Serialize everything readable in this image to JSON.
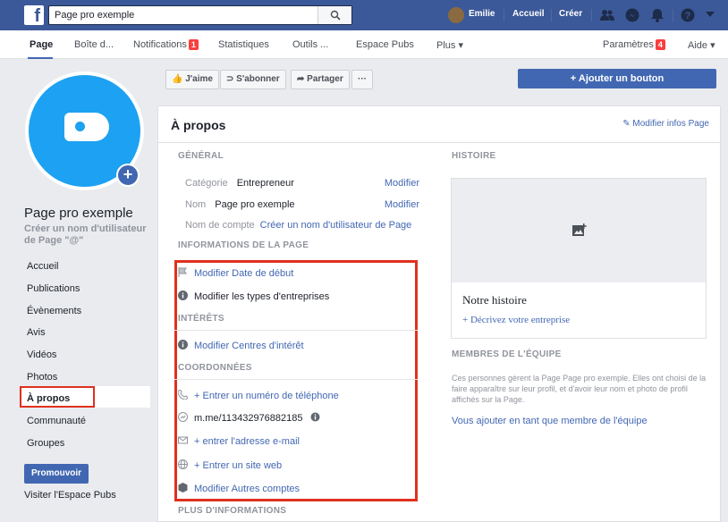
{
  "topbar": {
    "logo": "f",
    "search_value": "Page pro exemple",
    "user_name": "Emilie",
    "home_label": "Accueil",
    "create_label": "Créer"
  },
  "page_tabs": [
    {
      "label": "Page"
    },
    {
      "label": "Boîte d..."
    },
    {
      "label": "Notifications",
      "badge": "1"
    },
    {
      "label": "Statistiques"
    },
    {
      "label": "Outils ..."
    },
    {
      "label": "Espace Pubs"
    },
    {
      "label": "Plus ▾"
    },
    {
      "label": "Paramètres",
      "badge": "4"
    },
    {
      "label": "Aide ▾"
    }
  ],
  "sidebar": {
    "page_name": "Page pro exemple",
    "username_prompt": "Créer un nom d'utilisateur de Page \"@\"",
    "items": [
      "Accueil",
      "Publications",
      "Évènements",
      "Avis",
      "Vidéos",
      "Photos",
      "À propos",
      "Communauté",
      "Groupes"
    ],
    "promote_label": "Promouvoir",
    "visit_label": "Visiter l'Espace Pubs"
  },
  "action_bar": {
    "like": "J'aime",
    "subscribe": "S'abonner",
    "share": "Partager",
    "more": "···",
    "add_button": "+ Ajouter un bouton"
  },
  "about": {
    "title": "À propos",
    "edit_info": "Modifier infos Page",
    "general_heading": "GÉNÉRAL",
    "category_key": "Catégorie",
    "category_value": "Entrepreneur",
    "name_key": "Nom",
    "name_value": "Page pro exemple",
    "account_key": "Nom de compte",
    "account_value": "Créer un nom d'utilisateur de Page",
    "edit_label": "Modifier",
    "page_info_heading": "INFORMATIONS DE LA PAGE",
    "start_date": "Modifier Date de début",
    "business_types": "Modifier les types d'entreprises",
    "interests_heading": "INTÉRÊTS",
    "interests": "Modifier Centres d'intérêt",
    "contact_heading": "COORDONNÉES",
    "phone": "+ Entrer un numéro de téléphone",
    "messenger": "m.me/113432976882185",
    "email": "+ entrer l'adresse e-mail",
    "website": "+ Entrer un site web",
    "other_accounts": "Modifier Autres comptes",
    "more_info_heading": "PLUS D'INFORMATIONS"
  },
  "story": {
    "heading": "HISTOIRE",
    "title": "Notre histoire",
    "describe": "+ Décrivez votre entreprise"
  },
  "team": {
    "heading": "MEMBRES DE L'ÉQUIPE",
    "description": "Ces personnes gèrent la Page Page pro exemple. Elles ont choisi de la faire apparaître sur leur profil, et d'avoir leur nom et photo de profil affichés sur la Page.",
    "add_self": "Vous ajouter en tant que membre de l'équipe"
  },
  "colors": {
    "brand": "#3b5998",
    "link": "#4267b2",
    "highlight": "#e0301e",
    "profile": "#1da1f2"
  }
}
